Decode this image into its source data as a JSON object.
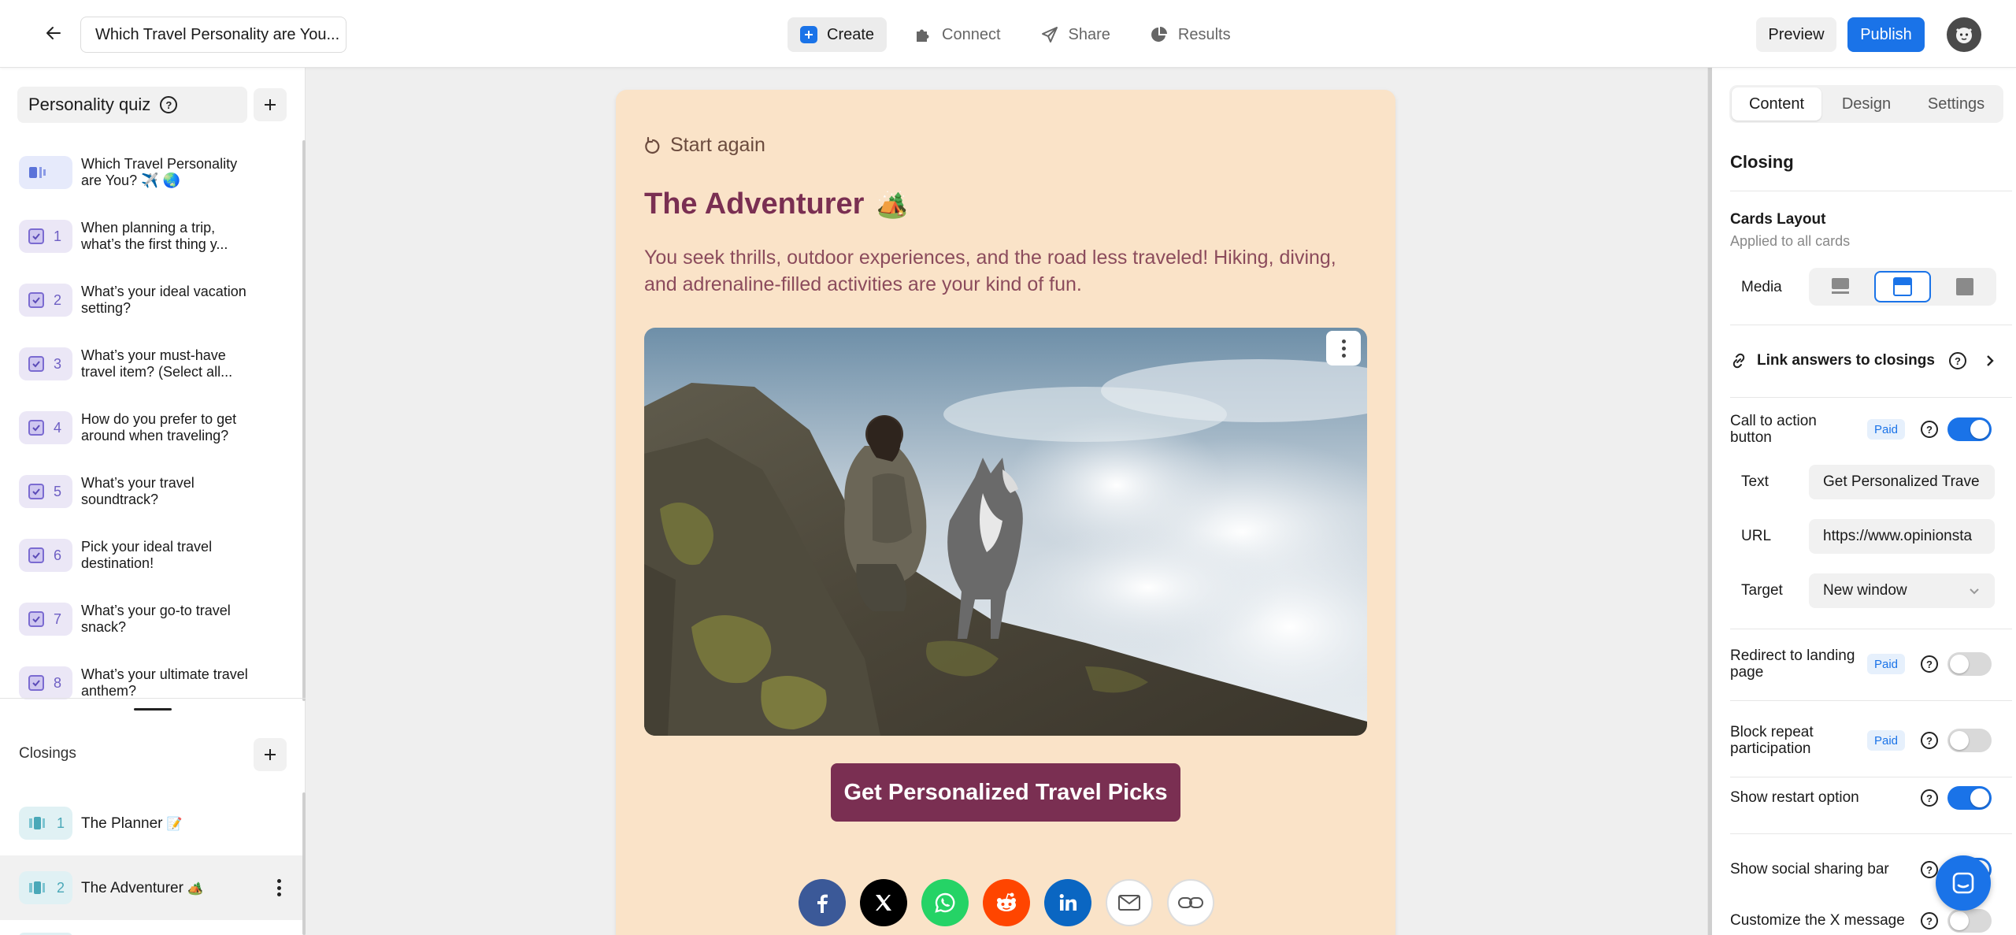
{
  "header": {
    "back_icon": "arrow-left-icon",
    "quiz_title": "Which Travel Personality are You...",
    "nav": [
      {
        "label": "Create",
        "icon": "plus-square-icon"
      },
      {
        "label": "Connect",
        "icon": "puzzle-icon"
      },
      {
        "label": "Share",
        "icon": "send-icon"
      },
      {
        "label": "Results",
        "icon": "pie-chart-icon"
      }
    ],
    "preview_label": "Preview",
    "publish_label": "Publish",
    "avatar_icon": "avatar-icon"
  },
  "sidebar": {
    "quiz_type": "Personality quiz",
    "questions": [
      {
        "num": "",
        "text": "Which Travel Personality are You? ✈️ 🌏",
        "icon": "intro-icon"
      },
      {
        "num": "1",
        "text": "When planning a trip, what’s the first thing y..."
      },
      {
        "num": "2",
        "text": "What’s your ideal vacation setting?"
      },
      {
        "num": "3",
        "text": "What’s your must-have travel item? (Select all..."
      },
      {
        "num": "4",
        "text": "How do you prefer to get around when traveling?"
      },
      {
        "num": "5",
        "text": "What’s your travel soundtrack?"
      },
      {
        "num": "6",
        "text": "Pick your ideal travel destination!"
      },
      {
        "num": "7",
        "text": "What’s your go-to travel snack?"
      },
      {
        "num": "8",
        "text": "What’s your ultimate travel anthem?"
      }
    ],
    "closings_label": "Closings",
    "closings": [
      {
        "num": "1",
        "text": "The Planner",
        "emoji": "📝"
      },
      {
        "num": "2",
        "text": "The Adventurer",
        "emoji": "🏕️"
      }
    ]
  },
  "card": {
    "restart_label": "Start again",
    "title": "The Adventurer",
    "title_emoji": "🏕️",
    "description": "You seek thrills, outdoor experiences, and the road less traveled! Hiking, diving, and adrenaline-filled activities are your kind of fun.",
    "cta_label": "Get Personalized Travel Picks",
    "share_icons": [
      "facebook-icon",
      "x-icon",
      "whatsapp-icon",
      "reddit-icon",
      "linkedin-icon",
      "email-icon",
      "link-icon"
    ],
    "background_color": "#fae3c8",
    "accent_color": "#7a2f52"
  },
  "panel": {
    "tabs": [
      "Content",
      "Design",
      "Settings"
    ],
    "active_tab": "Content",
    "section_title": "Closing",
    "cards_layout_label": "Cards Layout",
    "cards_layout_sub": "Applied to all cards",
    "media_label": "Media",
    "link_answers_label": "Link answers to closings",
    "cta_toggle_label": "Call to action button",
    "paid_badge": "Paid",
    "text_label": "Text",
    "text_value": "Get Personalized Trave",
    "url_label": "URL",
    "url_value": "https://www.opinionsta",
    "target_label": "Target",
    "target_value": "New window",
    "redirect_label": "Redirect to landing page",
    "block_repeat_label": "Block repeat participation",
    "show_restart_label": "Show restart option",
    "social_bar_label": "Show social sharing bar",
    "customize_x_label": "Customize the X message",
    "toggles": {
      "cta": true,
      "redirect": false,
      "block_repeat": false,
      "show_restart": true,
      "social_bar": true,
      "customize_x": false
    }
  },
  "chat_icon": "chat-icon",
  "colors": {
    "primary": "#1a73e8"
  }
}
